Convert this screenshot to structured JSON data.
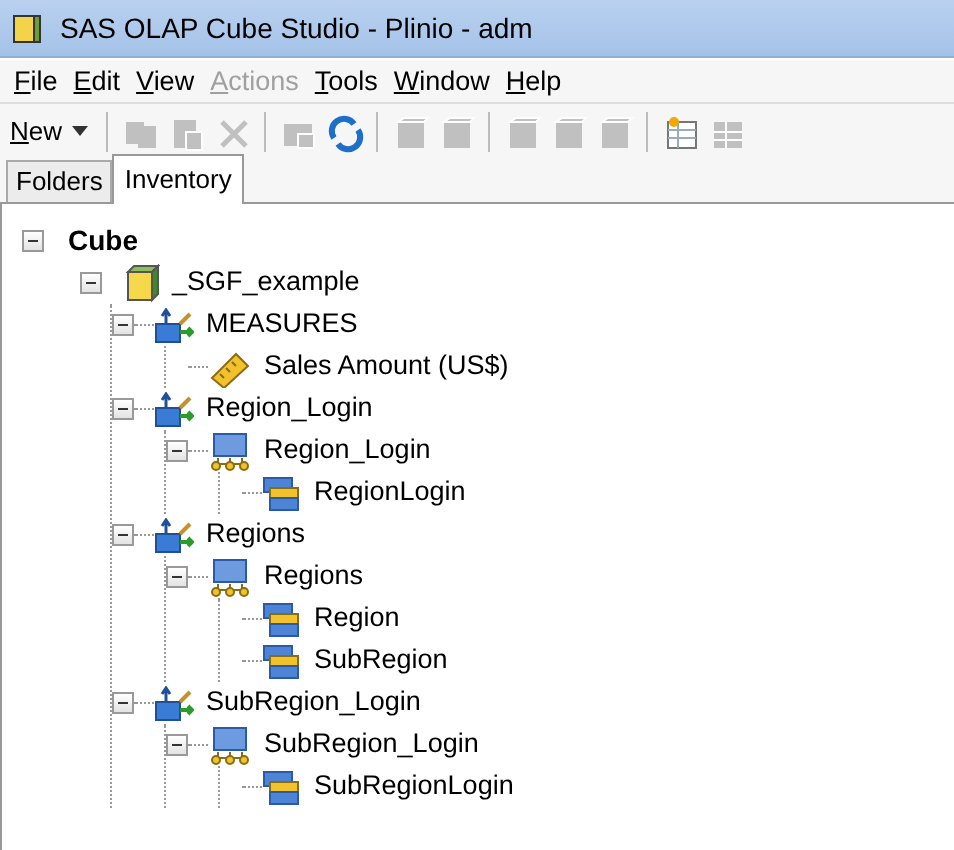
{
  "window": {
    "title": "SAS OLAP Cube Studio - Plinio - adm"
  },
  "menu": [
    {
      "label": "File",
      "disabled": false
    },
    {
      "label": "Edit",
      "disabled": false
    },
    {
      "label": "View",
      "disabled": false
    },
    {
      "label": "Actions",
      "disabled": true
    },
    {
      "label": "Tools",
      "disabled": false
    },
    {
      "label": "Window",
      "disabled": false
    },
    {
      "label": "Help",
      "disabled": false
    }
  ],
  "toolbar": {
    "new_button": "New",
    "tools": [
      {
        "kind": "copy",
        "disabled": true
      },
      {
        "kind": "paste",
        "disabled": true
      },
      {
        "kind": "delete",
        "disabled": true
      },
      {
        "kind": "separator"
      },
      {
        "kind": "move",
        "disabled": true
      },
      {
        "kind": "refresh",
        "disabled": false
      },
      {
        "kind": "separator"
      },
      {
        "kind": "cube",
        "disabled": true
      },
      {
        "kind": "cube",
        "disabled": true
      },
      {
        "kind": "separator"
      },
      {
        "kind": "cube",
        "disabled": true
      },
      {
        "kind": "cube",
        "disabled": true
      },
      {
        "kind": "cube",
        "disabled": true
      },
      {
        "kind": "separator"
      },
      {
        "kind": "properties",
        "disabled": false
      },
      {
        "kind": "grid",
        "disabled": true
      }
    ]
  },
  "tabs": [
    {
      "label": "Folders",
      "selected": false
    },
    {
      "label": "Inventory",
      "selected": true
    }
  ],
  "tree": [
    {
      "label": "Cube",
      "kind": "root",
      "expanded": true,
      "children": [
        {
          "label": "_SGF_example",
          "kind": "cube",
          "expanded": true,
          "children": [
            {
              "label": "MEASURES",
              "kind": "dimension",
              "expanded": true,
              "children": [
                {
                  "label": "Sales Amount (US$)",
                  "kind": "measure"
                }
              ]
            },
            {
              "label": "Region_Login",
              "kind": "dimension",
              "expanded": true,
              "children": [
                {
                  "label": "Region_Login",
                  "kind": "hierarchy",
                  "expanded": true,
                  "children": [
                    {
                      "label": "RegionLogin",
                      "kind": "level"
                    }
                  ]
                }
              ]
            },
            {
              "label": "Regions",
              "kind": "dimension",
              "expanded": true,
              "children": [
                {
                  "label": "Regions",
                  "kind": "hierarchy",
                  "expanded": true,
                  "children": [
                    {
                      "label": "Region",
                      "kind": "level"
                    },
                    {
                      "label": "SubRegion",
                      "kind": "level"
                    }
                  ]
                }
              ]
            },
            {
              "label": "SubRegion_Login",
              "kind": "dimension",
              "expanded": true,
              "children": [
                {
                  "label": "SubRegion_Login",
                  "kind": "hierarchy",
                  "expanded": true,
                  "children": [
                    {
                      "label": "SubRegionLogin",
                      "kind": "level"
                    }
                  ]
                }
              ]
            }
          ]
        }
      ]
    }
  ]
}
